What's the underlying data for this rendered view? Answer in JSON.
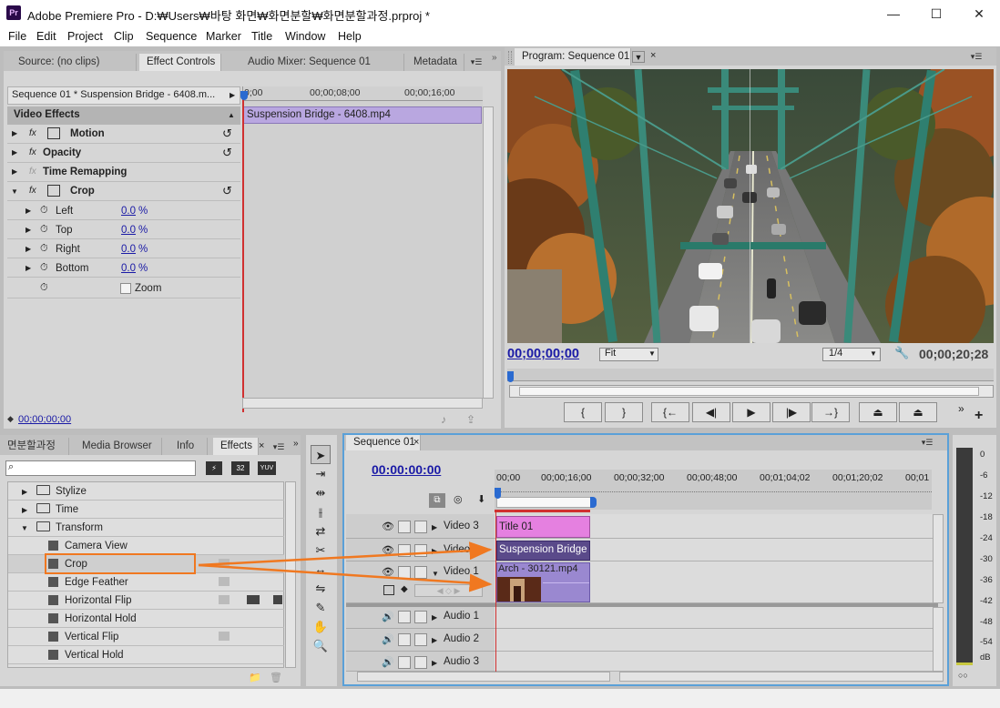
{
  "window": {
    "title": "Adobe Premiere Pro - D:₩Users₩바탕 화면₩화면분할₩화면분할과정.prproj *",
    "app_icon": "Pr",
    "minimize": "—",
    "maximize": "☐",
    "close": "✕"
  },
  "menu": [
    "File",
    "Edit",
    "Project",
    "Clip",
    "Sequence",
    "Marker",
    "Title",
    "Window",
    "Help"
  ],
  "source_panel": {
    "tabs": [
      "Source: (no clips)",
      "Effect Controls",
      "Audio Mixer: Sequence 01",
      "Metadata"
    ],
    "active_tab": 1,
    "sequence_label": "Sequence 01 * Suspension Bridge - 6408.m...",
    "ruler": [
      "0;00",
      "00;00;08;00",
      "00;00;16;00"
    ],
    "clip_label": "Suspension Bridge - 6408.mp4",
    "section": "Video Effects",
    "effects": [
      {
        "name": "Motion",
        "fx": "fx"
      },
      {
        "name": "Opacity",
        "fx": "fx"
      },
      {
        "name": "Time Remapping",
        "fx": "fx"
      },
      {
        "name": "Crop",
        "fx": "fx"
      }
    ],
    "crop_params": [
      {
        "name": "Left",
        "value": "0.0",
        "unit": "%"
      },
      {
        "name": "Top",
        "value": "0.0",
        "unit": "%"
      },
      {
        "name": "Right",
        "value": "0.0",
        "unit": "%"
      },
      {
        "name": "Bottom",
        "value": "0.0",
        "unit": "%"
      }
    ],
    "zoom_label": "Zoom",
    "timecode": "00;00;00;00"
  },
  "program_panel": {
    "tab": "Program: Sequence 01",
    "timecode": "00;00;00;00",
    "fit": "Fit",
    "resolution": "1/4",
    "duration": "00;00;20;28",
    "transport": [
      "{",
      "}",
      "{←",
      "◀|",
      "▶",
      "|▶",
      "→}",
      "⏏",
      "⏏"
    ]
  },
  "effects_panel": {
    "tabs": [
      "면분할과정",
      "Media Browser",
      "Info",
      "Effects"
    ],
    "active_tab": 3,
    "search_placeholder": "",
    "filter_icons": [
      "32",
      "YUV"
    ],
    "folders": [
      "Stylize",
      "Time",
      "Transform"
    ],
    "items": [
      "Camera View",
      "Crop",
      "Edge Feather",
      "Horizontal Flip",
      "Horizontal Hold",
      "Vertical Flip",
      "Vertical Hold"
    ],
    "selected": "Crop"
  },
  "timeline": {
    "tab": "Sequence 01",
    "timecode": "00:00:00:00",
    "ruler": [
      "00;00",
      "00;00;16;00",
      "00;00;32;00",
      "00;00;48;00",
      "00;01;04;02",
      "00;01;20;02",
      "00;01"
    ],
    "video_tracks": [
      "Video 3",
      "Video 2",
      "Video 1"
    ],
    "audio_tracks": [
      "Audio 1",
      "Audio 2",
      "Audio 3"
    ],
    "clips": {
      "title": "Title 01",
      "bridge": "Suspension Bridge",
      "arch": "Arch - 30121.mp4"
    }
  },
  "audio_meter": {
    "labels": [
      "0",
      "-6",
      "-12",
      "-18",
      "-24",
      "-30",
      "-36",
      "-42",
      "-48",
      "-54",
      "dB"
    ]
  },
  "colors": {
    "accent": "#f07820",
    "playhead": "#d03030",
    "title_clip": "#e580e0",
    "bridge_clip": "#5a4a8a",
    "arch_clip": "#9a88d0"
  }
}
